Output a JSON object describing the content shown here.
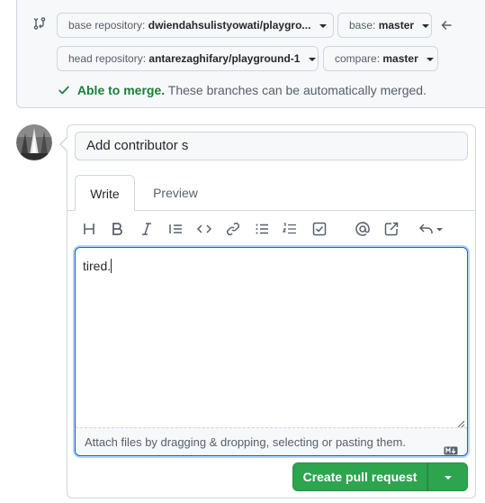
{
  "compare": {
    "base_repo_label": "base repository:",
    "base_repo_value": "dwiendahsulistyowati/playgro...",
    "base_label": "base:",
    "base_value": "master",
    "head_repo_label": "head repository:",
    "head_repo_value": "antarezaghifary/playground-1",
    "compare_label": "compare:",
    "compare_value": "master",
    "merge_status": "Able to merge.",
    "merge_detail": "These branches can be automatically merged."
  },
  "form": {
    "title_value": "Add contributor s",
    "tabs": [
      {
        "label": "Write",
        "active": true
      },
      {
        "label": "Preview",
        "active": false
      }
    ],
    "toolbar_icons": [
      "heading-icon",
      "bold-icon",
      "italic-icon",
      "quote-icon",
      "code-icon",
      "link-icon",
      "bullet-list-icon",
      "numbered-list-icon",
      "task-list-icon",
      "mention-icon",
      "reference-icon",
      "reply-icon"
    ],
    "body_value": "tired.",
    "attach_text": "Attach files by dragging & dropping, selecting or pasting them.",
    "submit_label": "Create pull request"
  },
  "colors": {
    "accent": "#0969da",
    "success": "#2da44e",
    "border": "#d0d7de"
  }
}
